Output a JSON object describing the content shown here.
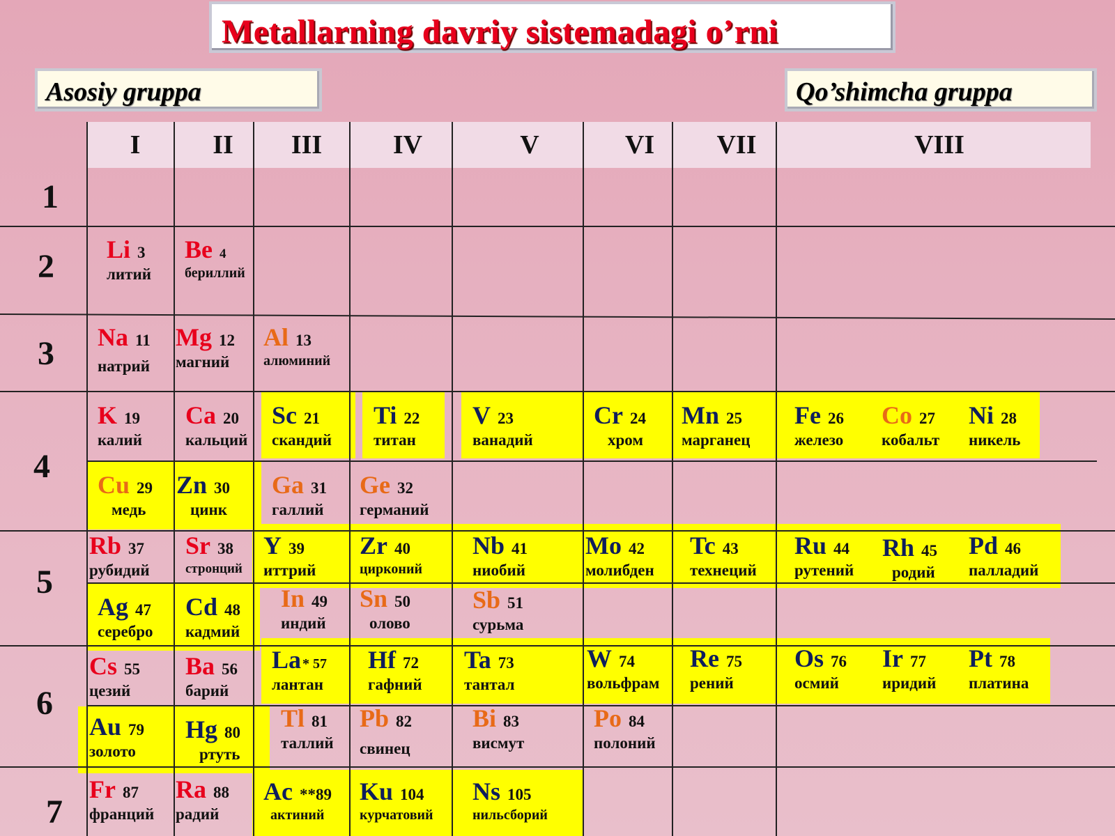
{
  "title": "Metallarning  davriy  sistemadagi  o’rni",
  "label_main": "Asosiy gruppa",
  "label_sub": "Qo’shimcha gruppa",
  "groups": [
    "I",
    "II",
    "III",
    "IV",
    "V",
    "VI",
    "VII",
    "VIII"
  ],
  "periods": [
    "1",
    "2",
    "3",
    "4",
    "5",
    "6",
    "7"
  ],
  "colors": {
    "red": "#e8001c",
    "orange": "#e86a17",
    "blue": "#0f1e5c",
    "highlight": "#ffff00"
  },
  "elements": {
    "Li": {
      "symbol": "Li",
      "number": "3",
      "name": "литий"
    },
    "Be": {
      "symbol": "Be",
      "number": "4",
      "name": "бериллий"
    },
    "Na": {
      "symbol": "Na",
      "number": "11",
      "name": "натрий"
    },
    "Mg": {
      "symbol": "Mg",
      "number": "12",
      "name": "магний"
    },
    "Al": {
      "symbol": "Al",
      "number": "13",
      "name": "алюминий"
    },
    "K": {
      "symbol": "K",
      "number": "19",
      "name": "калий"
    },
    "Ca": {
      "symbol": "Ca",
      "number": "20",
      "name": "кальций"
    },
    "Sc": {
      "symbol": "Sc",
      "number": "21",
      "name": "скандий"
    },
    "Ti": {
      "symbol": "Ti",
      "number": "22",
      "name": "титан"
    },
    "V": {
      "symbol": "V",
      "number": "23",
      "name": "ванадий"
    },
    "Cr": {
      "symbol": "Cr",
      "number": "24",
      "name": "хром"
    },
    "Mn": {
      "symbol": "Mn",
      "number": "25",
      "name": "марганец"
    },
    "Fe": {
      "symbol": "Fe",
      "number": "26",
      "name": "железо"
    },
    "Co": {
      "symbol": "Co",
      "number": "27",
      "name": "кобальт"
    },
    "Ni": {
      "symbol": "Ni",
      "number": "28",
      "name": "никель"
    },
    "Cu": {
      "symbol": "Cu",
      "number": "29",
      "name": "медь"
    },
    "Zn": {
      "symbol": "Zn",
      "number": "30",
      "name": "цинк"
    },
    "Ga": {
      "symbol": "Ga",
      "number": "31",
      "name": "галлий"
    },
    "Ge": {
      "symbol": "Ge",
      "number": "32",
      "name": "германий"
    },
    "Rb": {
      "symbol": "Rb",
      "number": "37",
      "name": "рубидий"
    },
    "Sr": {
      "symbol": "Sr",
      "number": "38",
      "name": "стронций"
    },
    "Y": {
      "symbol": "Y",
      "number": "39",
      "name": "иттрий"
    },
    "Zr": {
      "symbol": "Zr",
      "number": "40",
      "name": "цирконий"
    },
    "Nb": {
      "symbol": "Nb",
      "number": "41",
      "name": "ниобий"
    },
    "Mo": {
      "symbol": "Mo",
      "number": "42",
      "name": "молибден"
    },
    "Tc": {
      "symbol": "Tc",
      "number": "43",
      "name": "технеций"
    },
    "Ru": {
      "symbol": "Ru",
      "number": "44",
      "name": "рутений"
    },
    "Rh": {
      "symbol": "Rh",
      "number": "45",
      "name": "родий"
    },
    "Pd": {
      "symbol": "Pd",
      "number": "46",
      "name": "палладий"
    },
    "Ag": {
      "symbol": "Ag",
      "number": "47",
      "name": "серебро"
    },
    "Cd": {
      "symbol": "Cd",
      "number": "48",
      "name": "кадмий"
    },
    "In": {
      "symbol": "In",
      "number": "49",
      "name": "индий"
    },
    "Sn": {
      "symbol": "Sn",
      "number": "50",
      "name": "олово"
    },
    "Sb": {
      "symbol": "Sb",
      "number": "51",
      "name": "сурьма"
    },
    "Cs": {
      "symbol": "Cs",
      "number": "55",
      "name": "цезий"
    },
    "Ba": {
      "symbol": "Ba",
      "number": "56",
      "name": "барий"
    },
    "La": {
      "symbol": "La",
      "number": "* 57",
      "name": "лантан"
    },
    "Hf": {
      "symbol": "Hf",
      "number": "72",
      "name": "гафний"
    },
    "Ta": {
      "symbol": "Ta",
      "number": "73",
      "name": "тантал"
    },
    "W": {
      "symbol": "W",
      "number": "74",
      "name": "вольфрам"
    },
    "Re": {
      "symbol": "Re",
      "number": "75",
      "name": "рений"
    },
    "Os": {
      "symbol": "Os",
      "number": "76",
      "name": "осмий"
    },
    "Ir": {
      "symbol": "Ir",
      "number": "77",
      "name": "иридий"
    },
    "Pt": {
      "symbol": "Pt",
      "number": "78",
      "name": "платина"
    },
    "Au": {
      "symbol": "Au",
      "number": "79",
      "name": "золото"
    },
    "Hg": {
      "symbol": "Hg",
      "number": "80",
      "name": "ртуть"
    },
    "Tl": {
      "symbol": "Tl",
      "number": "81",
      "name": "таллий"
    },
    "Pb": {
      "symbol": "Pb",
      "number": "82",
      "name": "свинец"
    },
    "Bi": {
      "symbol": "Bi",
      "number": "83",
      "name": "висмут"
    },
    "Po": {
      "symbol": "Po",
      "number": "84",
      "name": "полоний"
    },
    "Fr": {
      "symbol": "Fr",
      "number": "87",
      "name": "франций"
    },
    "Ra": {
      "symbol": "Ra",
      "number": "88",
      "name": "радий"
    },
    "Ac": {
      "symbol": "Ac",
      "number": "**89",
      "name": "актиний"
    },
    "Ku": {
      "symbol": "Ku",
      "number": "104",
      "name": "курчатовий"
    },
    "Ns": {
      "symbol": "Ns",
      "number": "105",
      "name": "нильсборий"
    }
  }
}
